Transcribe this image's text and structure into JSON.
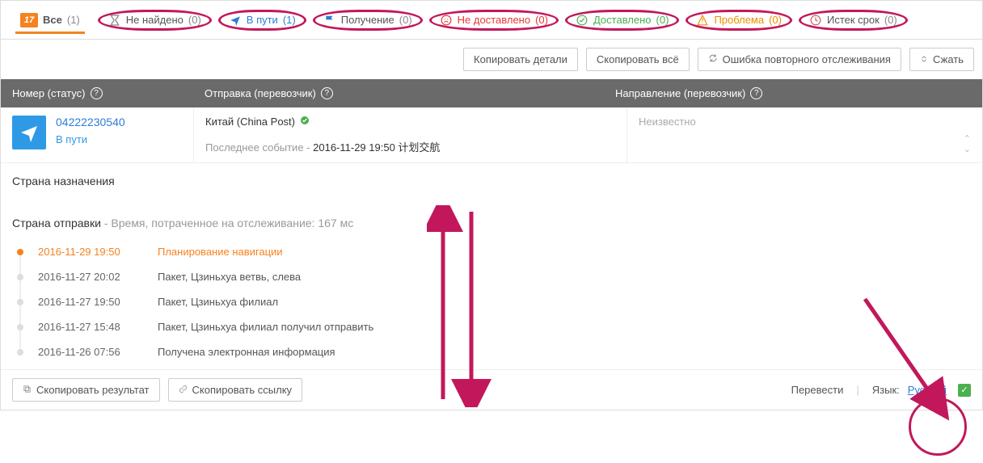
{
  "tabs": {
    "all": {
      "label": "Все",
      "count": "(1)"
    },
    "notfound": {
      "label": "Не найдено",
      "count": "(0)"
    },
    "intransit": {
      "label": "В пути",
      "count": "(1)"
    },
    "pickup": {
      "label": "Получение",
      "count": "(0)"
    },
    "undelivered": {
      "label": "Не доставлено",
      "count": "(0)"
    },
    "delivered": {
      "label": "Доставлено",
      "count": "(0)"
    },
    "problem": {
      "label": "Проблема",
      "count": "(0)"
    },
    "expired": {
      "label": "Истек срок",
      "count": "(0)"
    }
  },
  "actions": {
    "copy_details": "Копировать детали",
    "copy_all": "Скопировать всё",
    "retrack_error": "Ошибка повторного отслеживания",
    "collapse": "Сжать"
  },
  "header": {
    "col_number": "Номер (статус)",
    "col_shipment": "Отправка (перевозчик)",
    "col_direction": "Направление (перевозчик)"
  },
  "entry": {
    "tracking_no": "04222230540",
    "status": "В пути",
    "carrier": "Китай (China Post)",
    "last_event_label": "Последнее событие -",
    "last_event_value": "2016-11-29 19:50 计划交航",
    "destination_unknown": "Неизвестно"
  },
  "details": {
    "dest_country_label": "Страна назначения",
    "origin_country_label": "Страна отправки",
    "time_spent_label": "Время, потраченное на отслеживание: 167 мс"
  },
  "events": [
    {
      "ts": "2016-11-29 19:50",
      "desc": "Планирование навигации"
    },
    {
      "ts": "2016-11-27 20:02",
      "desc": "Пакет, Цзиньхуа ветвь, слева"
    },
    {
      "ts": "2016-11-27 19:50",
      "desc": "Пакет, Цзиньхуа филиал"
    },
    {
      "ts": "2016-11-27 15:48",
      "desc": "Пакет, Цзиньхуа филиал получил отправить"
    },
    {
      "ts": "2016-11-26 07:56",
      "desc": "Получена электронная информация"
    }
  ],
  "footer": {
    "copy_result": "Скопировать результат",
    "copy_link": "Скопировать ссылку",
    "translate": "Перевести",
    "language_label": "Язык:",
    "language_value": "Русский"
  }
}
